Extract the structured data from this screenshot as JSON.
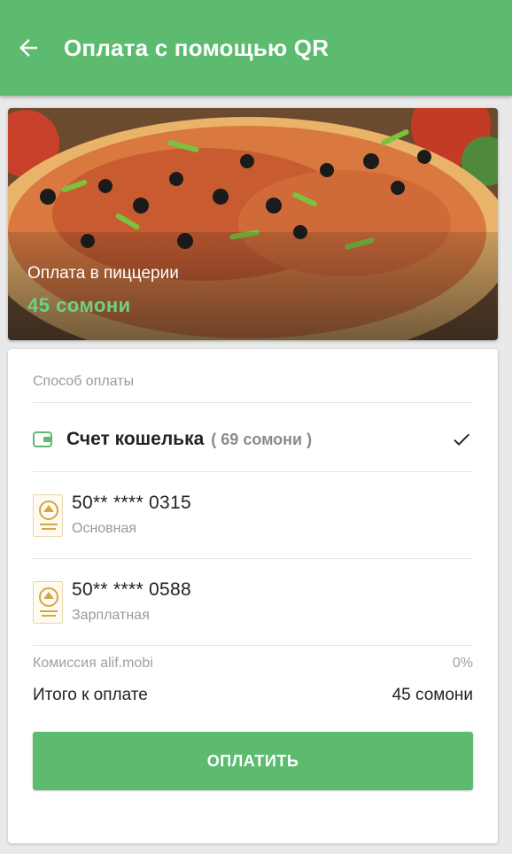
{
  "appbar": {
    "title": "Оплата с помощью QR",
    "back_icon": "arrow-left-icon",
    "color": "#5cbb6e"
  },
  "hero": {
    "merchant_label": "Оплата в пиццерии",
    "amount": "45 сомони",
    "amount_color": "#6ed27f"
  },
  "payment": {
    "section_label": "Способ оплаты",
    "wallet": {
      "name": "Счет кошелька",
      "balance": "( 69 сомони )",
      "icon": "wallet-icon",
      "selected": true
    },
    "cards": [
      {
        "number": "50** **** 0315",
        "label": "Основная"
      },
      {
        "number": "50** **** 0588",
        "label": "Зарплатная"
      }
    ]
  },
  "summary": {
    "fee_label": "Комиссия alif.mobi",
    "fee_value": "0%",
    "total_label": "Итого к оплате",
    "total_value": "45 сомони"
  },
  "pay_button": {
    "label": "ОПЛАТИТЬ",
    "color": "#5cbb6e"
  }
}
